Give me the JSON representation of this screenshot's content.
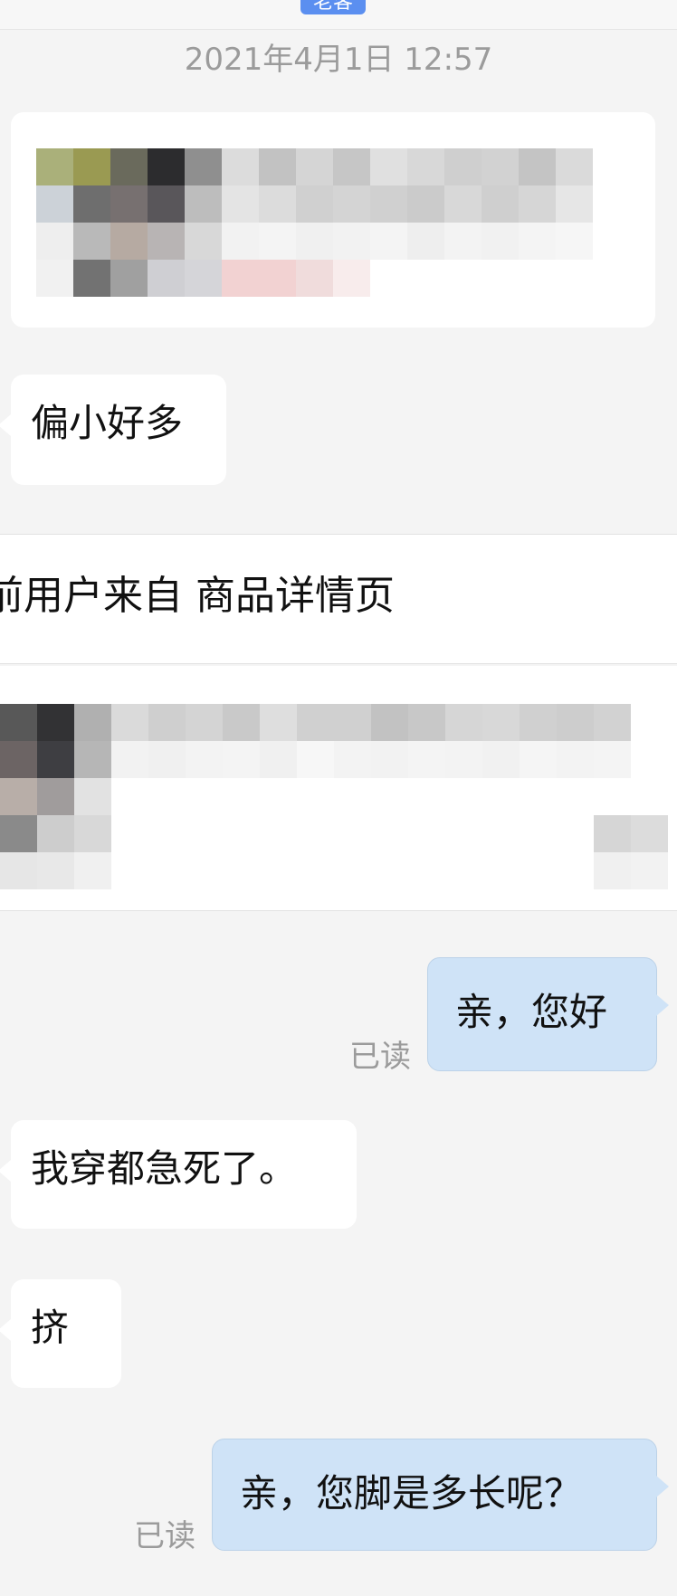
{
  "header": {
    "badge_label": "老客",
    "timestamp": "2021年4月1日 12:57"
  },
  "messages": {
    "m1": {
      "text": "偏小好多"
    },
    "source": {
      "text": "前用户来自 商品详情页"
    },
    "m2": {
      "text": "亲，您好",
      "status": "已读"
    },
    "m3": {
      "text": "我穿都急死了。"
    },
    "m4": {
      "text": "挤"
    },
    "m5": {
      "text": "亲，您脚是多长呢？",
      "status": "已读"
    }
  },
  "colors": {
    "badge": "#5b8ff0",
    "outgoing_bubble": "#cfe3f7",
    "incoming_bubble": "#ffffff",
    "background": "#f4f4f4"
  },
  "icons": {
    "pixelated_image_top": "pixelated-photo-icon",
    "pixelated_product": "pixelated-product-icon"
  }
}
